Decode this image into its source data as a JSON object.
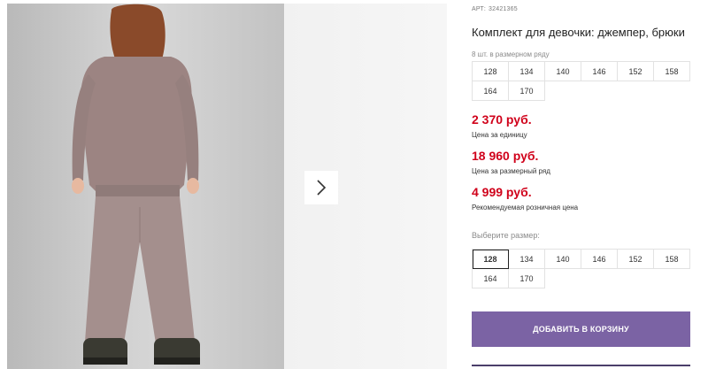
{
  "product": {
    "article_label": "АРТ:",
    "article_number": "32421365",
    "title": "Комплект для девочки: джемпер, брюки",
    "sizes_note": "8 шт. в размерном ряду"
  },
  "size_range": [
    "128",
    "134",
    "140",
    "146",
    "152",
    "158",
    "164",
    "170"
  ],
  "prices": {
    "unit_price": "2 370 руб.",
    "unit_label": "Цена за единицу",
    "range_price": "18 960 руб.",
    "range_label": "Цена за размерный ряд",
    "retail_price": "4 999 руб.",
    "retail_label": "Рекомендуемая розничная цена"
  },
  "size_selector": {
    "label": "Выберите размер:",
    "options": [
      "128",
      "134",
      "140",
      "146",
      "152",
      "158",
      "164",
      "170"
    ],
    "selected": "128"
  },
  "actions": {
    "add_to_cart": "ДОБАВИТЬ В КОРЗИНУ"
  },
  "icons": {
    "next": "chevron-right-icon"
  },
  "colors": {
    "price": "#d0021b",
    "button": "#7b63a4"
  }
}
